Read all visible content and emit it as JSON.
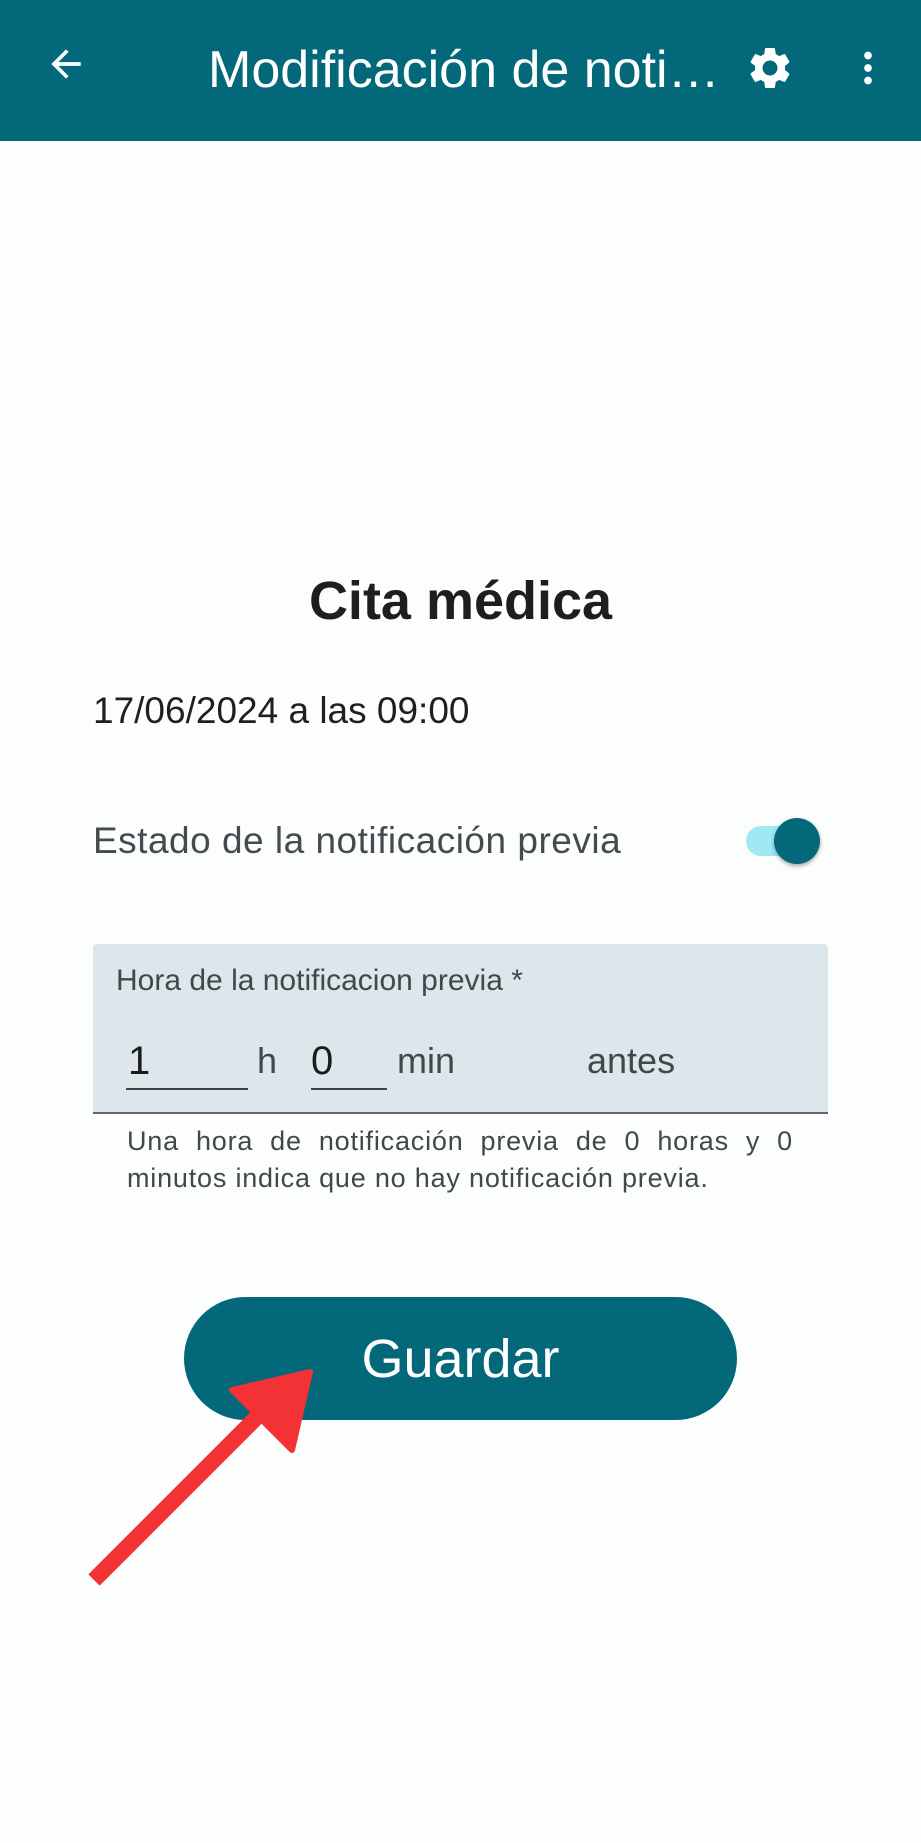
{
  "app_bar": {
    "title": "Modificación de noti…",
    "back_icon": "arrow-left-icon",
    "settings_icon": "gear-icon",
    "more_icon": "more-vert-icon",
    "color": "#02687a"
  },
  "event": {
    "title": "Cita médica",
    "datetime": "17/06/2024 a las 09:00"
  },
  "notification_status": {
    "label": "Estado de la notificación previa",
    "enabled": true
  },
  "advance_time": {
    "label": "Hora de la notificacion previa *",
    "hours_value": "1",
    "hours_unit": "h",
    "minutes_value": "0",
    "minutes_unit": "min",
    "suffix": "antes",
    "helper_text": "Una hora de notificación previa de 0 horas y 0 minutos indica que no hay notificación previa."
  },
  "actions": {
    "save_label": "Guardar"
  },
  "annotation": {
    "arrow_icon": "red-arrow-pointer",
    "color": "#f33235"
  }
}
